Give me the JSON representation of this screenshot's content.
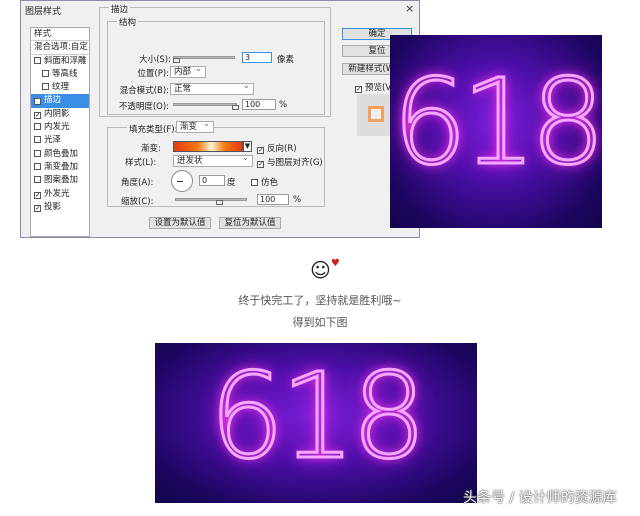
{
  "dialog": {
    "title": "图层样式",
    "close": "×",
    "sidebar": {
      "header": "样式",
      "blend": "混合选项:自定",
      "items": [
        {
          "label": "斜面和浮雕",
          "checked": false,
          "indent": false
        },
        {
          "label": "等高线",
          "checked": false,
          "indent": true
        },
        {
          "label": "纹理",
          "checked": false,
          "indent": true
        },
        {
          "label": "描边",
          "checked": true,
          "indent": false,
          "selected": true
        },
        {
          "label": "内阴影",
          "checked": true,
          "indent": false
        },
        {
          "label": "内发光",
          "checked": false,
          "indent": false
        },
        {
          "label": "光泽",
          "checked": false,
          "indent": false
        },
        {
          "label": "颜色叠加",
          "checked": false,
          "indent": false
        },
        {
          "label": "渐变叠加",
          "checked": false,
          "indent": false
        },
        {
          "label": "图案叠加",
          "checked": false,
          "indent": false
        },
        {
          "label": "外发光",
          "checked": true,
          "indent": false
        },
        {
          "label": "投影",
          "checked": true,
          "indent": false
        }
      ]
    },
    "stroke": {
      "title": "描边",
      "structure": "结构",
      "size_label": "大小(S):",
      "size_value": "3",
      "size_unit": "像素",
      "position_label": "位置(P):",
      "position_value": "内部",
      "blend_label": "混合模式(B):",
      "blend_value": "正常",
      "opacity_label": "不透明度(O):",
      "opacity_value": "100",
      "opacity_unit": "%",
      "opacity": 100,
      "fill_type_label": "填充类型(F):",
      "fill_type_value": "渐变",
      "gradient_label": "渐变:",
      "reverse_label": "反向(R)",
      "style_label": "样式(L):",
      "style_value": "迸发状",
      "align_label": "与图层对齐(G)",
      "angle_label": "角度(A):",
      "angle_value": "0",
      "angle_unit": "度",
      "dither_label": "仿色",
      "scale_label": "缩放(C):",
      "scale_value": "100",
      "scale_unit": "%",
      "set_default": "设置为默认值",
      "reset_default": "复位为默认值"
    },
    "buttons": {
      "ok": "确定",
      "reset": "复位",
      "new_style": "新建样式(W)...",
      "preview": "预览(V)"
    }
  },
  "image_text": "618",
  "caption": {
    "line1": "终于快完工了，坚持就是胜利哦~",
    "line2": "得到如下图"
  },
  "watermark": "头条号 / 设计师的资源库",
  "colors": {
    "selected": "#3a8ee6",
    "bg_dark": "#1c0660",
    "neon": "#ff3cf0"
  }
}
